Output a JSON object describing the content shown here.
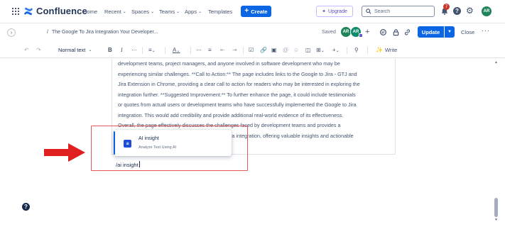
{
  "topnav": {
    "app_name": "Confluence",
    "items": [
      {
        "label": "Home",
        "has_menu": false
      },
      {
        "label": "Recent",
        "has_menu": true
      },
      {
        "label": "Spaces",
        "has_menu": true
      },
      {
        "label": "Teams",
        "has_menu": true
      },
      {
        "label": "Apps",
        "has_menu": true
      },
      {
        "label": "Templates",
        "has_menu": false
      }
    ],
    "create_label": "Create",
    "upgrade_label": "Upgrade",
    "search_placeholder": "Search",
    "notification_count": "7",
    "user_initials": "AR"
  },
  "pagebar": {
    "breadcrumb": "The Google To Jira Integration Your Developer...",
    "status": "Saved",
    "collaborators": [
      "AR",
      "AR"
    ],
    "update_label": "Update",
    "close_label": "Close"
  },
  "toolbar": {
    "text_style": "Normal text",
    "write_label": "Write"
  },
  "editor": {
    "paragraph_lines": [
      "development teams, project managers, and anyone involved in software development who may be",
      "experiencing similar challenges. **Call to Action:** The page includes links to the Google to Jira - GTJ and",
      "Jira Extension in Chrome, providing a clear call to action for readers who may be interested in exploring the",
      "integration further. **Suggested Improvement:** To further enhance the page, it could include testimonials",
      "or quotes from actual users or development teams who have successfully implemented the Google to Jira",
      "integration. This would add credibility and provide additional real-world evidence of its effectiveness.",
      "Overall, the page effectively discusses the challenges faced by development teams and provides a",
      "ra integration, offering valuable insights and actionable"
    ],
    "slash_command": "/ai insight",
    "suggestion": {
      "title": "AI insight",
      "subtitle": "Analyze Text Using AI"
    }
  },
  "colors": {
    "primary": "#0c66e4",
    "annotation_red": "#e02020",
    "highlight_border": "#e45959",
    "avatar_green": "#1f845a",
    "avatar_teal": "#0f8a6a",
    "badge_red": "#c9372c"
  },
  "icons": [
    "apps-grid-icon",
    "confluence-logo-icon",
    "plus-icon",
    "sparkle-icon",
    "search-icon",
    "bell-icon",
    "help-icon",
    "gear-icon",
    "chevron-right-icon",
    "undo-icon",
    "redo-icon",
    "bold-icon",
    "italic-icon",
    "align-icon",
    "text-color-icon",
    "bullet-list-icon",
    "numbered-list-icon",
    "checkbox-icon",
    "link-icon",
    "image-icon",
    "mention-icon",
    "emoji-icon",
    "table-icon",
    "write-icon",
    "arrow-right-icon"
  ]
}
